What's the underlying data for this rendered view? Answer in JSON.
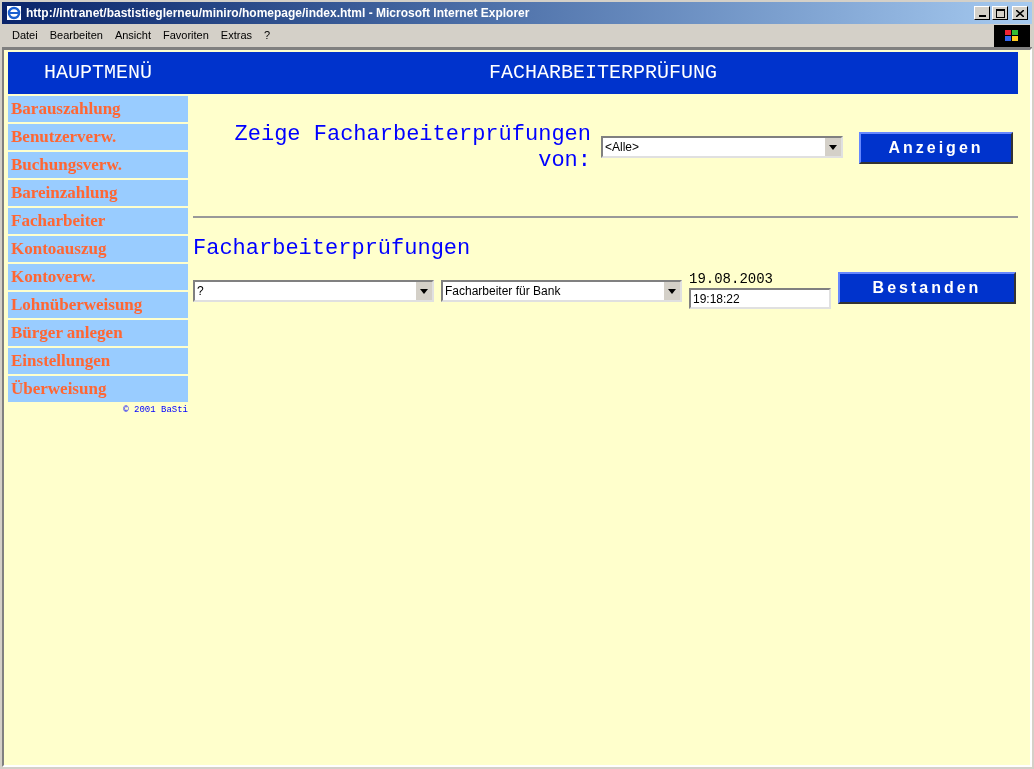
{
  "window": {
    "title": "http://intranet/bastistieglerneu/miniro/homepage/index.html - Microsoft Internet Explorer"
  },
  "menu_bar": [
    "Datei",
    "Bearbeiten",
    "Ansicht",
    "Favoriten",
    "Extras",
    "?"
  ],
  "header": {
    "menu_title": "HAUPTMENÜ",
    "page_title": "FACHARBEITERPRÜFUNG"
  },
  "sidebar": {
    "items": [
      "Barauszahlung",
      "Benutzerverw.",
      "Buchungsverw.",
      "Bareinzahlung",
      "Facharbeiter",
      "Kontoauszug",
      "Kontoverw.",
      "Lohnüberweisung",
      "Bürger anlegen",
      "Einstellungen",
      "Überweisung"
    ],
    "footer": "© 2001 BaSti"
  },
  "filter": {
    "label": "Zeige Facharbeiterprüfungen von:",
    "select": "<Alle>",
    "button": "Anzeigen"
  },
  "section": {
    "heading": "Facharbeiterprüfungen",
    "row": {
      "select_1": "?",
      "select_2": "Facharbeiter für Bank",
      "date": "19.08.2003",
      "time": "19:18:22",
      "button": "Bestanden"
    }
  }
}
